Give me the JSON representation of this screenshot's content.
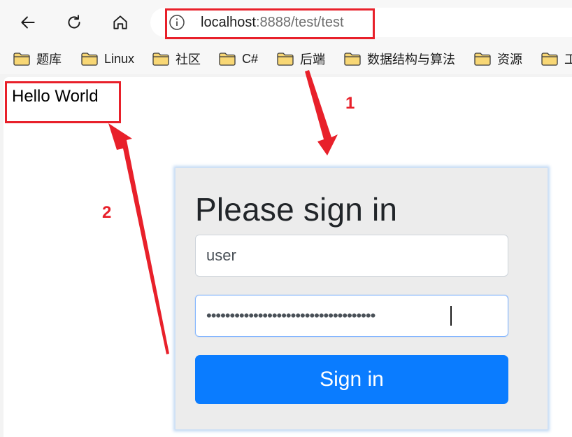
{
  "browser": {
    "url_host": "localhost",
    "url_rest": ":8888/test/test",
    "nav_icons": [
      "back-arrow-icon",
      "reload-icon",
      "home-icon",
      "info-icon"
    ]
  },
  "bookmarks": [
    {
      "label": "题库"
    },
    {
      "label": "Linux"
    },
    {
      "label": "社区"
    },
    {
      "label": "C#"
    },
    {
      "label": "后端"
    },
    {
      "label": "数据结构与算法"
    },
    {
      "label": "资源"
    },
    {
      "label": "工"
    }
  ],
  "page": {
    "hello": "Hello World"
  },
  "login": {
    "title": "Please sign in",
    "username_value": "user",
    "password_value": "••••••••••••••••••••••••••••••••••••",
    "button_label": "Sign in"
  },
  "annotations": {
    "label_1": "1",
    "label_2": "2",
    "color": "#e8202a"
  },
  "colors": {
    "primary_button": "#0a7cff",
    "card_background": "#ececec",
    "folder": "#f8d775"
  }
}
